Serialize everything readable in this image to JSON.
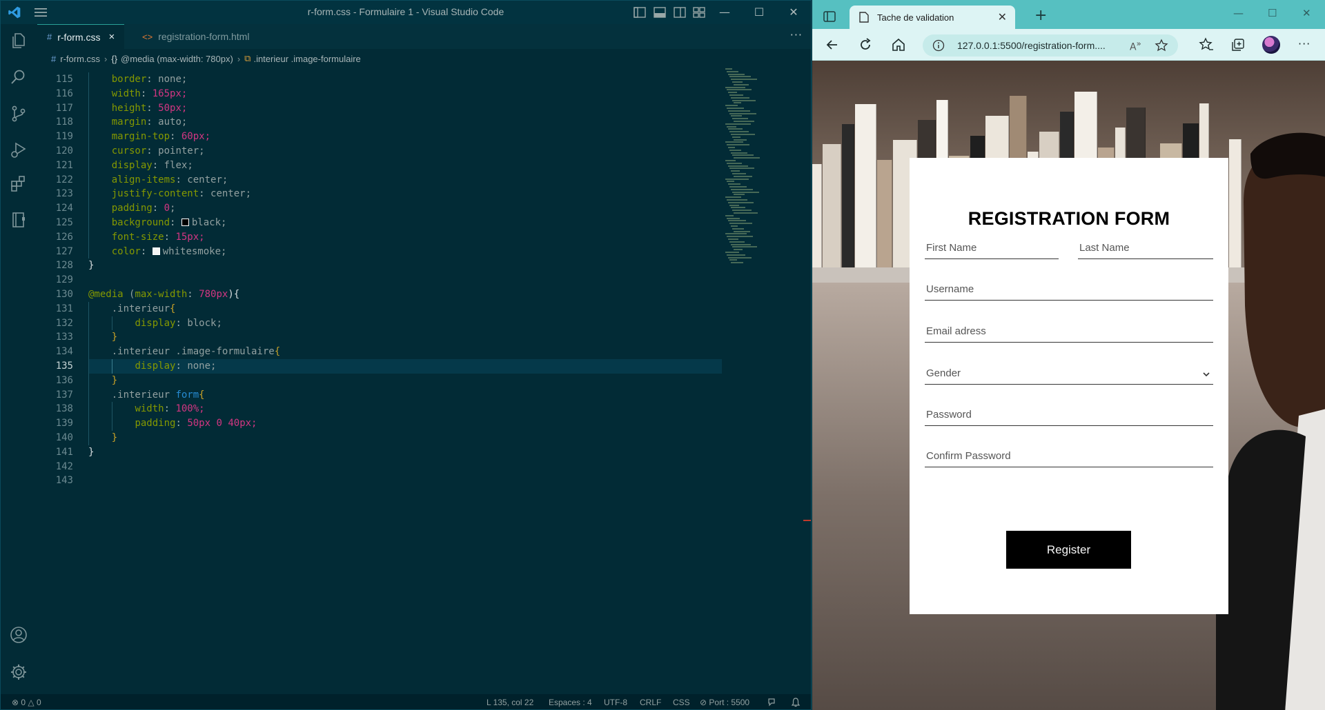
{
  "vscode": {
    "title": "r-form.css - Formulaire 1 - Visual Studio Code",
    "tabs": [
      {
        "icon": "#",
        "label": "r-form.css",
        "close": "×"
      },
      {
        "icon": "<>",
        "label": "registration-form.html"
      }
    ],
    "tabs_more": "···",
    "breadcrumb": {
      "file": "r-form.css",
      "media": "@media (max-width: 780px)",
      "selector": ".interieur .image-formulaire"
    },
    "line_numbers": [
      "115",
      "116",
      "117",
      "118",
      "119",
      "120",
      "121",
      "122",
      "123",
      "124",
      "125",
      "126",
      "127",
      "128",
      "129",
      "130",
      "131",
      "132",
      "133",
      "134",
      "135",
      "136",
      "137",
      "138",
      "139",
      "140",
      "141",
      "142",
      "143"
    ],
    "code": {
      "l115": {
        "prop": "border",
        "val": " none;"
      },
      "l116": {
        "prop": "width",
        "num": "165",
        "unit": "px;"
      },
      "l117": {
        "prop": "height",
        "num": "50",
        "unit": "px;"
      },
      "l118": {
        "prop": "margin",
        "val": " auto;"
      },
      "l119": {
        "prop": "margin-top",
        "num": "60",
        "unit": "px;"
      },
      "l120": {
        "prop": "cursor",
        "val": " pointer;"
      },
      "l121": {
        "prop": "display",
        "val": " flex;"
      },
      "l122": {
        "prop": "align-items",
        "val": " center;"
      },
      "l123": {
        "prop": "justify-content",
        "val": " center;"
      },
      "l124": {
        "prop": "padding",
        "num": "0",
        "unit": ";"
      },
      "l125": {
        "prop": "background",
        "val": "black;"
      },
      "l126": {
        "prop": "font-size",
        "num": "15",
        "unit": "px;"
      },
      "l127": {
        "prop": "color",
        "val": "whitesmoke;"
      },
      "l128": {
        "brace": "}"
      },
      "l130": {
        "at": "@media",
        "paren_open": " (",
        "prop": "max-width",
        "num": "780",
        "unit": "px",
        "rest": "){"
      },
      "l131": {
        "sel": ".interieur",
        "brace": "{"
      },
      "l132": {
        "prop": "display",
        "val": " block;"
      },
      "l133": {
        "brace": "}"
      },
      "l134": {
        "sel": ".interieur .image-formulaire",
        "brace": "{"
      },
      "l135": {
        "prop": "display",
        "val": " none;"
      },
      "l136": {
        "brace": "}"
      },
      "l137": {
        "sel": ".interieur ",
        "tag": "form",
        "brace": "{"
      },
      "l138": {
        "prop": "width",
        "num": "100",
        "unit": "%;"
      },
      "l139": {
        "prop": "padding",
        "num1": "50",
        "u1": "px ",
        "num2": "0",
        "sp": " ",
        "num3": "40",
        "u3": "px;"
      },
      "l140": {
        "brace": "}"
      },
      "l141": {
        "brace": "}"
      }
    },
    "colors": {
      "swatch_black": "#000000",
      "swatch_whitesmoke": "#f5f5f5"
    },
    "status": {
      "problems": "⊗ 0 △ 0",
      "position": "L 135, col 22",
      "spaces": "Espaces : 4",
      "encoding": "UTF-8",
      "eol": "CRLF",
      "lang": "CSS",
      "port": "⊘ Port : 5500"
    }
  },
  "browser": {
    "tab_title": "Tache de validation",
    "url": "127.0.0.1:5500/registration-form....",
    "form": {
      "title": "REGISTRATION FORM",
      "first_name": "First Name",
      "last_name": "Last Name",
      "username": "Username",
      "email": "Email adress",
      "gender": "Gender",
      "password": "Password",
      "confirm_password": "Confirm Password",
      "register": "Register"
    }
  }
}
